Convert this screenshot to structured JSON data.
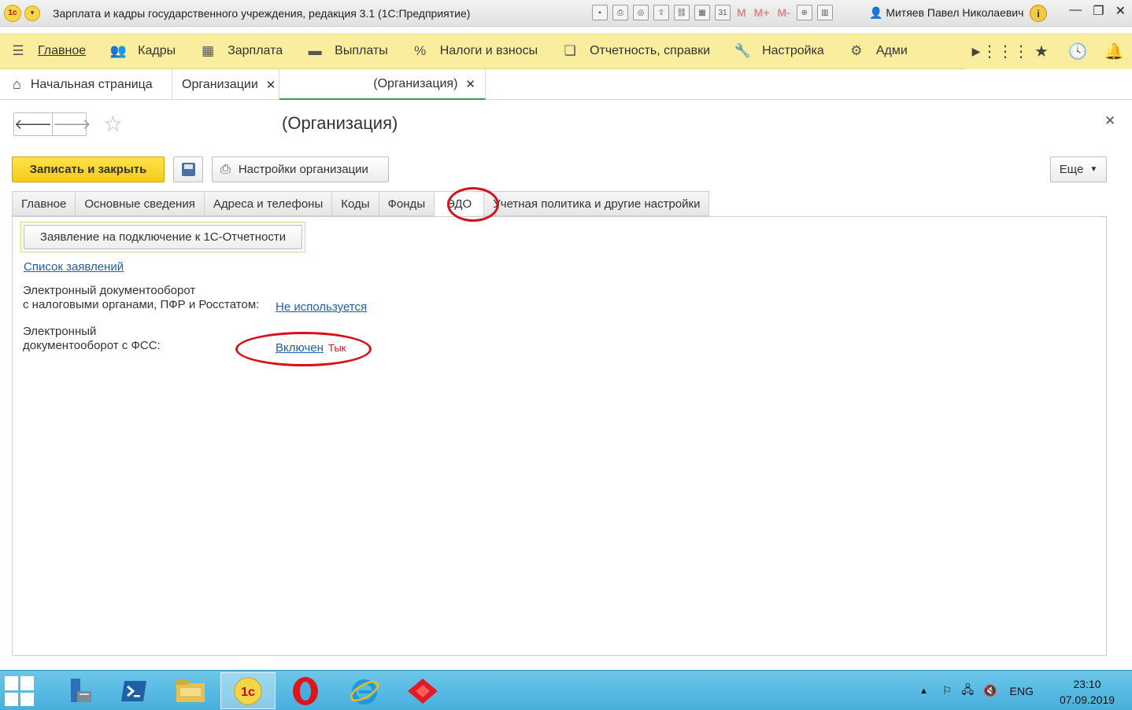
{
  "window": {
    "title": "Зарплата и кадры государственного учреждения, редакция 3.1  (1С:Предприятие)",
    "logo_text": "1c",
    "user": "Митяев Павел Николаевич",
    "memory_buttons": [
      "M",
      "M+",
      "M-"
    ]
  },
  "sections": {
    "items": [
      {
        "label": "Главное",
        "icon": "menu-icon"
      },
      {
        "label": "Кадры",
        "icon": "people-icon"
      },
      {
        "label": "Зарплата",
        "icon": "calculator-icon"
      },
      {
        "label": "Выплаты",
        "icon": "wallet-icon"
      },
      {
        "label": "Налоги и взносы",
        "icon": "percent-icon"
      },
      {
        "label": "Отчетность, справки",
        "icon": "reports-icon"
      },
      {
        "label": "Настройка",
        "icon": "wrench-icon"
      },
      {
        "label": "Адми",
        "icon": "gear-icon"
      }
    ]
  },
  "open_tabs": {
    "home": "Начальная страница",
    "organizations": "Организации",
    "current": "(Организация)"
  },
  "form": {
    "title": "(Организация)",
    "save_close": "Записать и закрыть",
    "org_settings": "Настройки организации",
    "more": "Еще",
    "tabs": [
      "Главное",
      "Основные сведения",
      "Адреса и телефоны",
      "Коды",
      "Фонды",
      "ЭДО",
      "Учетная политика и другие настройки"
    ],
    "active_tab": "ЭДО",
    "statement_button": "Заявление на подключение к 1С-Отчетности",
    "statement_list_link": "Список заявлений",
    "edo_tax_label_line1": "Электронный документооборот",
    "edo_tax_label_line2": "с налоговыми органами, ПФР и Росстатом:",
    "edo_tax_value": "Не используется",
    "edo_fss_label_line1": "Электронный",
    "edo_fss_label_line2": "документооборот с ФСС:",
    "edo_fss_value": "Включен",
    "annotation": "Тык"
  },
  "taskbar": {
    "lang": "ENG",
    "time": "23:10",
    "date": "07.09.2019"
  },
  "colors": {
    "section_bar": "#fbed9e",
    "primary_button": "#f5cc15",
    "link": "#1f5fa8",
    "annotation": "#d8101c",
    "taskbar": "#47afdc"
  }
}
